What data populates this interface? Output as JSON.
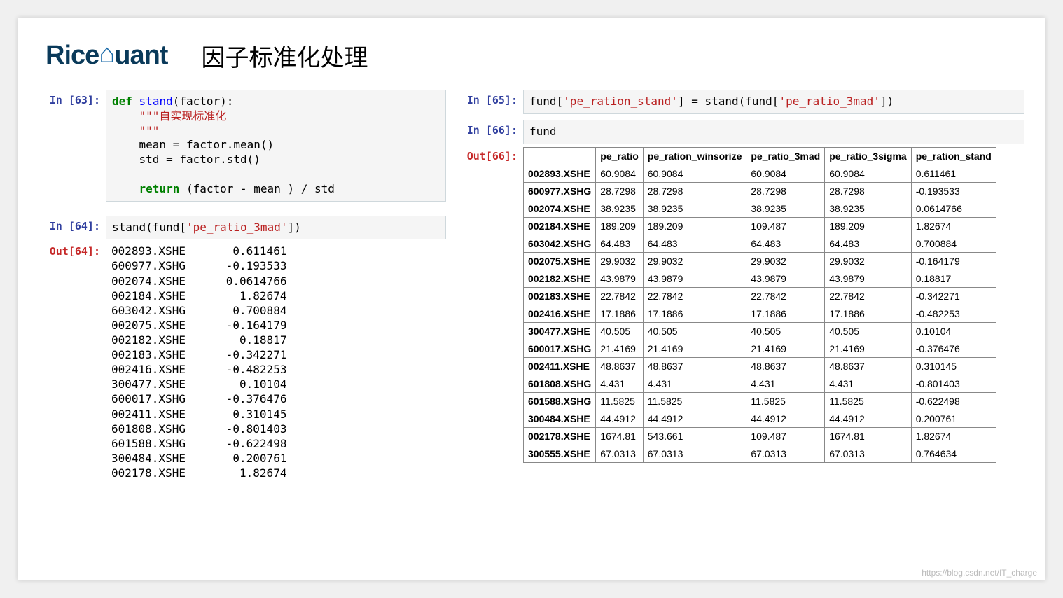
{
  "logo_part1": "Rice",
  "logo_part2": "uant",
  "title": "因子标准化处理",
  "cell63": {
    "prompt": "In [63]:",
    "code_html": "<span class=\"kw\">def</span> <span class=\"fn\">stand</span>(factor):\n    <span class=\"cmt\">\"\"\"自实现标准化\n    \"\"\"</span>\n    mean = factor.mean()\n    std = factor.std()\n\n    <span class=\"kw\">return</span> (factor - mean ) / std"
  },
  "cell64": {
    "prompt": "In [64]:",
    "code_html": "stand(fund[<span class=\"str\">'pe_ratio_3mad'</span>])",
    "out_prompt": "Out[64]:",
    "output_rows": [
      [
        "002893.XSHE",
        "0.611461"
      ],
      [
        "600977.XSHG",
        "-0.193533"
      ],
      [
        "002074.XSHE",
        "0.0614766"
      ],
      [
        "002184.XSHE",
        "1.82674"
      ],
      [
        "603042.XSHG",
        "0.700884"
      ],
      [
        "002075.XSHE",
        "-0.164179"
      ],
      [
        "002182.XSHE",
        "0.18817"
      ],
      [
        "002183.XSHE",
        "-0.342271"
      ],
      [
        "002416.XSHE",
        "-0.482253"
      ],
      [
        "300477.XSHE",
        "0.10104"
      ],
      [
        "600017.XSHG",
        "-0.376476"
      ],
      [
        "002411.XSHE",
        "0.310145"
      ],
      [
        "601808.XSHG",
        "-0.801403"
      ],
      [
        "601588.XSHG",
        "-0.622498"
      ],
      [
        "300484.XSHE",
        "0.200761"
      ],
      [
        "002178.XSHE",
        "1.82674"
      ]
    ]
  },
  "cell65": {
    "prompt": "In [65]:",
    "code_html": "fund[<span class=\"str\">'pe_ration_stand'</span>] = stand(fund[<span class=\"str\">'pe_ratio_3mad'</span>])"
  },
  "cell66": {
    "prompt": "In [66]:",
    "code_html": "fund",
    "out_prompt": "Out[66]:",
    "table_headers": [
      "",
      "pe_ratio",
      "pe_ration_winsorize",
      "pe_ratio_3mad",
      "pe_ratio_3sigma",
      "pe_ration_stand"
    ],
    "table_rows": [
      [
        "002893.XSHE",
        "60.9084",
        "60.9084",
        "60.9084",
        "60.9084",
        "0.611461"
      ],
      [
        "600977.XSHG",
        "28.7298",
        "28.7298",
        "28.7298",
        "28.7298",
        "-0.193533"
      ],
      [
        "002074.XSHE",
        "38.9235",
        "38.9235",
        "38.9235",
        "38.9235",
        "0.0614766"
      ],
      [
        "002184.XSHE",
        "189.209",
        "189.209",
        "109.487",
        "189.209",
        "1.82674"
      ],
      [
        "603042.XSHG",
        "64.483",
        "64.483",
        "64.483",
        "64.483",
        "0.700884"
      ],
      [
        "002075.XSHE",
        "29.9032",
        "29.9032",
        "29.9032",
        "29.9032",
        "-0.164179"
      ],
      [
        "002182.XSHE",
        "43.9879",
        "43.9879",
        "43.9879",
        "43.9879",
        "0.18817"
      ],
      [
        "002183.XSHE",
        "22.7842",
        "22.7842",
        "22.7842",
        "22.7842",
        "-0.342271"
      ],
      [
        "002416.XSHE",
        "17.1886",
        "17.1886",
        "17.1886",
        "17.1886",
        "-0.482253"
      ],
      [
        "300477.XSHE",
        "40.505",
        "40.505",
        "40.505",
        "40.505",
        "0.10104"
      ],
      [
        "600017.XSHG",
        "21.4169",
        "21.4169",
        "21.4169",
        "21.4169",
        "-0.376476"
      ],
      [
        "002411.XSHE",
        "48.8637",
        "48.8637",
        "48.8637",
        "48.8637",
        "0.310145"
      ],
      [
        "601808.XSHG",
        "4.431",
        "4.431",
        "4.431",
        "4.431",
        "-0.801403"
      ],
      [
        "601588.XSHG",
        "11.5825",
        "11.5825",
        "11.5825",
        "11.5825",
        "-0.622498"
      ],
      [
        "300484.XSHE",
        "44.4912",
        "44.4912",
        "44.4912",
        "44.4912",
        "0.200761"
      ],
      [
        "002178.XSHE",
        "1674.81",
        "543.661",
        "109.487",
        "1674.81",
        "1.82674"
      ],
      [
        "300555.XSHE",
        "67.0313",
        "67.0313",
        "67.0313",
        "67.0313",
        "0.764634"
      ]
    ]
  },
  "watermark": "https://blog.csdn.net/IT_charge"
}
